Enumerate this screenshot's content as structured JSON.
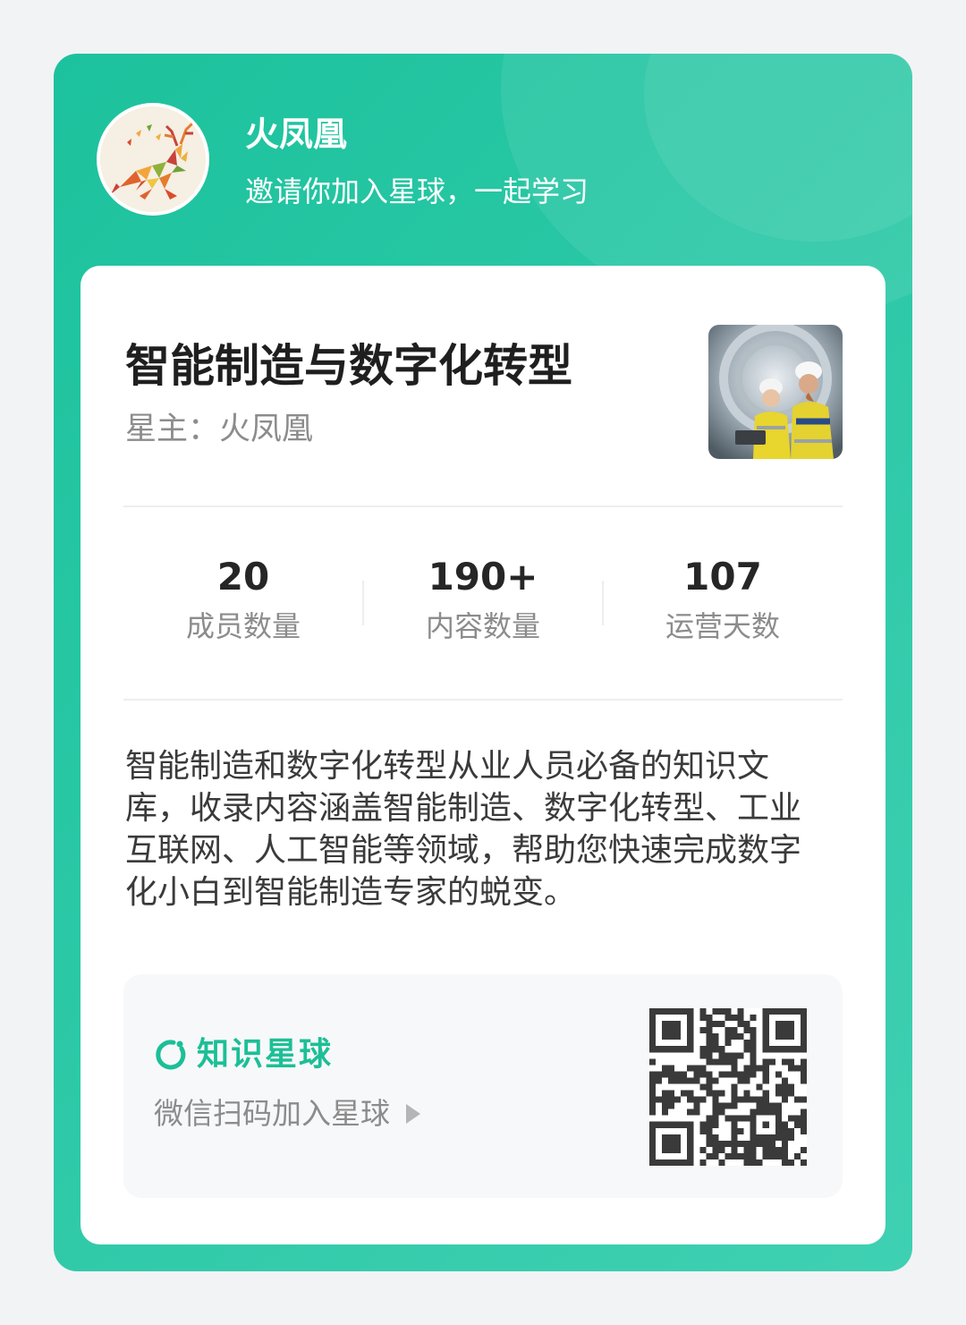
{
  "header": {
    "host_name": "火凤凰",
    "invite_text": "邀请你加入星球，一起学习"
  },
  "group": {
    "title": "智能制造与数字化转型",
    "owner_line": "星主：火凤凰",
    "cover_image_icon": "engineers-photo"
  },
  "stats": [
    {
      "value": "20",
      "label": "成员数量"
    },
    {
      "value": "190+",
      "label": "内容数量"
    },
    {
      "value": "107",
      "label": "运营天数"
    }
  ],
  "description": "智能制造和数字化转型从业人员必备的知识文库，收录内容涵盖智能制造、数字化转型、工业互联网、人工智能等领域，帮助您快速完成数字化小白到智能制造专家的蜕变。",
  "join": {
    "brand_name": "知识星球",
    "scan_hint": "微信扫码加入星球",
    "qr_icon": "qr-code"
  },
  "colors": {
    "brand_green": "#1cc29d",
    "brand_text_green": "#1cbf96",
    "title_text": "#1f1f1f",
    "muted_text": "#8c8c8c"
  }
}
